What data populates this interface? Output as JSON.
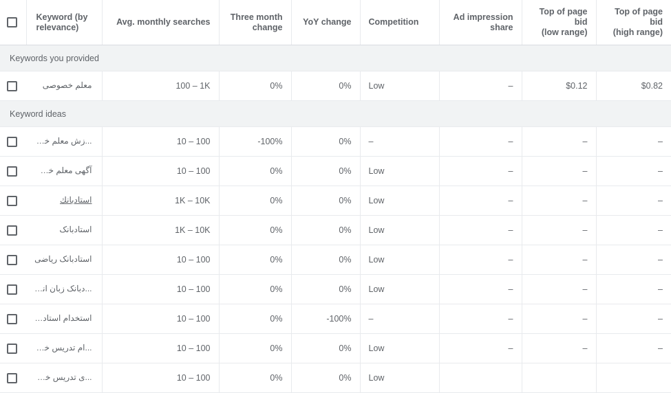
{
  "table": {
    "columns": [
      {
        "key": "select",
        "label": "",
        "align": "check"
      },
      {
        "key": "keyword",
        "label": "Keyword (by relevance)",
        "align": "left"
      },
      {
        "key": "avg",
        "label": "Avg. monthly searches",
        "align": "right"
      },
      {
        "key": "three_month",
        "label": "Three month change",
        "align": "right"
      },
      {
        "key": "yoy",
        "label": "YoY change",
        "align": "right"
      },
      {
        "key": "competition",
        "label": "Competition",
        "align": "left"
      },
      {
        "key": "ad_share",
        "label": "Ad impression share",
        "align": "right"
      },
      {
        "key": "bid_low",
        "label": "Top of page bid (low range)",
        "align": "right"
      },
      {
        "key": "bid_high",
        "label": "Top of page bid (high range)",
        "align": "right"
      }
    ],
    "header_labels": {
      "keyword_line1": "Keyword (by",
      "keyword_line2": "relevance)",
      "avg": "Avg. monthly searches",
      "three_month_line1": "Three month",
      "three_month_line2": "change",
      "yoy": "YoY change",
      "competition": "Competition",
      "ad_share_line1": "Ad impression",
      "ad_share_line2": "share",
      "bid_low_line1": "Top of page bid",
      "bid_low_line2": "(low range)",
      "bid_high_line1": "Top of page bid",
      "bid_high_line2": "(high range)"
    },
    "groups": [
      {
        "title": "Keywords you provided",
        "rows": [
          {
            "keyword": "معلم خصوصی",
            "avg": "100 – 1K",
            "three_month": "0%",
            "yoy": "0%",
            "competition": "Low",
            "ad_share": "–",
            "bid_low": "$0.12",
            "bid_high": "$0.82",
            "hovered": false
          }
        ]
      },
      {
        "title": "Keyword ideas",
        "rows": [
          {
            "keyword": "...زش معلم خصوصی",
            "avg": "10 – 100",
            "three_month": "-100%",
            "yoy": "0%",
            "competition": "–",
            "ad_share": "–",
            "bid_low": "–",
            "bid_high": "–",
            "hovered": false
          },
          {
            "keyword": "آگهی معلم خصوصی",
            "avg": "10 – 100",
            "three_month": "0%",
            "yoy": "0%",
            "competition": "Low",
            "ad_share": "–",
            "bid_low": "–",
            "bid_high": "–",
            "hovered": false
          },
          {
            "keyword": "استادبانك",
            "avg": "1K – 10K",
            "three_month": "0%",
            "yoy": "0%",
            "competition": "Low",
            "ad_share": "–",
            "bid_low": "–",
            "bid_high": "–",
            "hovered": true
          },
          {
            "keyword": "استادبانک",
            "avg": "1K – 10K",
            "three_month": "0%",
            "yoy": "0%",
            "competition": "Low",
            "ad_share": "–",
            "bid_low": "–",
            "bid_high": "–",
            "hovered": false
          },
          {
            "keyword": "استادبانک ریاضی",
            "avg": "10 – 100",
            "three_month": "0%",
            "yoy": "0%",
            "competition": "Low",
            "ad_share": "–",
            "bid_low": "–",
            "bid_high": "–",
            "hovered": false
          },
          {
            "keyword": "...دبانک زبان انگلیسی",
            "avg": "10 – 100",
            "three_month": "0%",
            "yoy": "0%",
            "competition": "Low",
            "ad_share": "–",
            "bid_low": "–",
            "bid_high": "–",
            "hovered": false
          },
          {
            "keyword": "استخدام استادبانک",
            "avg": "10 – 100",
            "three_month": "0%",
            "yoy": "-100%",
            "competition": "–",
            "ad_share": "–",
            "bid_low": "–",
            "bid_high": "–",
            "hovered": false
          },
          {
            "keyword": "...ام تدریس خصوصی",
            "avg": "10 – 100",
            "three_month": "0%",
            "yoy": "0%",
            "competition": "Low",
            "ad_share": "–",
            "bid_low": "–",
            "bid_high": "–",
            "hovered": false
          },
          {
            "keyword": "...ی تدریس خصوصی",
            "avg": "10 – 100",
            "three_month": "0%",
            "yoy": "0%",
            "competition": "Low",
            "ad_share": "",
            "bid_low": "",
            "bid_high": "",
            "hovered": false
          }
        ]
      }
    ],
    "colors": {
      "text": "#5f6368",
      "group_background": "#f1f3f4",
      "border": "#e8eaed",
      "header_border": "#dadce0"
    }
  }
}
